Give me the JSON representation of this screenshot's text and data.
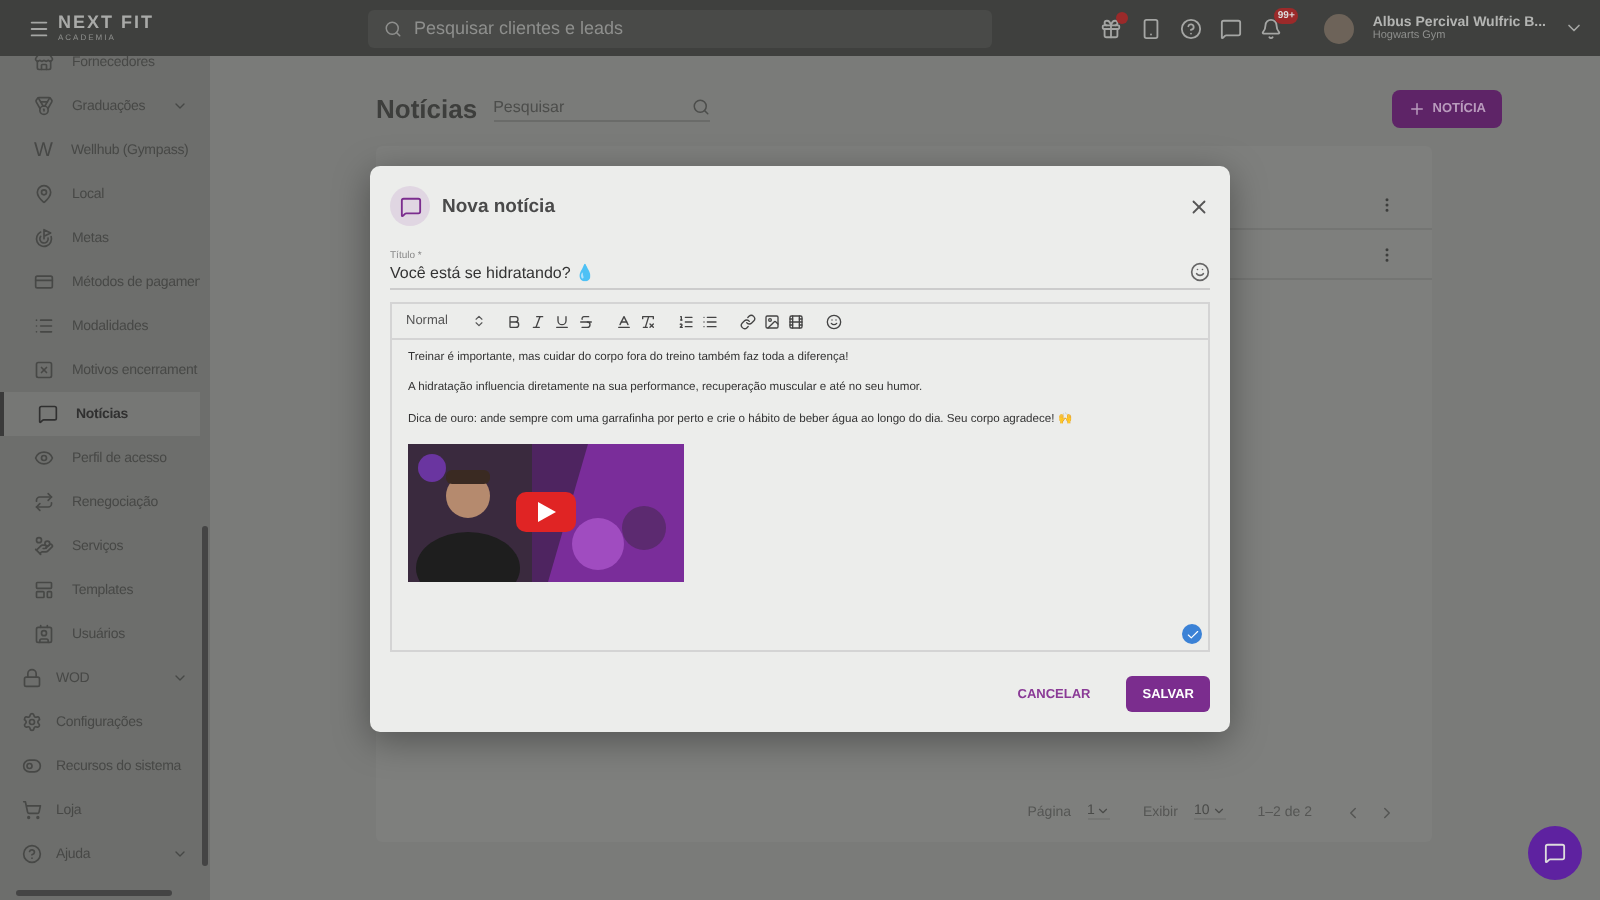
{
  "topbar": {
    "brand": "NEXT FIT",
    "brand_sub": "ACADEMIA",
    "search": {
      "placeholder": "Pesquisar clientes e leads"
    },
    "notifications_badge": "99+",
    "user": {
      "name": "Albus Percival Wulfric B...",
      "gym": "Hogwarts Gym"
    }
  },
  "sidebar": {
    "items": [
      {
        "label": "Fornecedores",
        "kind": "subitem",
        "expandable": false,
        "selected": false
      },
      {
        "label": "Graduações",
        "kind": "subitem",
        "expandable": true,
        "selected": false
      },
      {
        "label": "Wellhub (Gympass)",
        "kind": "subitem",
        "glyph": "W",
        "expandable": false,
        "selected": false
      },
      {
        "label": "Local",
        "kind": "subitem",
        "expandable": false,
        "selected": false
      },
      {
        "label": "Metas",
        "kind": "subitem",
        "expandable": false,
        "selected": false
      },
      {
        "label": "Métodos de pagamen",
        "kind": "subitem",
        "expandable": false,
        "selected": false
      },
      {
        "label": "Modalidades",
        "kind": "subitem",
        "expandable": false,
        "selected": false
      },
      {
        "label": "Motivos encerrament",
        "kind": "subitem",
        "expandable": false,
        "selected": false
      },
      {
        "label": "Notícias",
        "kind": "subitem",
        "expandable": false,
        "selected": true
      },
      {
        "label": "Perfil de acesso",
        "kind": "subitem",
        "expandable": false,
        "selected": false
      },
      {
        "label": "Renegociação",
        "kind": "subitem",
        "expandable": false,
        "selected": false
      },
      {
        "label": "Serviços",
        "kind": "subitem",
        "expandable": false,
        "selected": false
      },
      {
        "label": "Templates",
        "kind": "subitem",
        "expandable": false,
        "selected": false
      },
      {
        "label": "Usuários",
        "kind": "subitem",
        "expandable": false,
        "selected": false
      },
      {
        "label": "WOD",
        "kind": "item",
        "expandable": true,
        "selected": false
      },
      {
        "label": "Configurações",
        "kind": "item",
        "expandable": false,
        "selected": false
      },
      {
        "label": "Recursos do sistema",
        "kind": "item",
        "expandable": false,
        "selected": false
      },
      {
        "label": "Loja",
        "kind": "item",
        "expandable": false,
        "selected": false
      },
      {
        "label": "Ajuda",
        "kind": "item",
        "expandable": true,
        "selected": false
      }
    ]
  },
  "page": {
    "title": "Notícias",
    "search": {
      "placeholder": "Pesquisar"
    },
    "new_button": "NOTÍCIA",
    "pagination": {
      "page_label": "Página",
      "page": "1",
      "show_label": "Exibir",
      "per_page": "10",
      "range": "1–2 de 2"
    }
  },
  "dialog": {
    "title": "Nova notícia",
    "field_label": "Título *",
    "field_value": "Você está se hidratando? 💧",
    "editor": {
      "format": "Normal",
      "paragraphs": [
        "Treinar é importante, mas cuidar do corpo fora do treino também faz toda a diferença!",
        "A hidratação influencia diretamente na sua performance, recuperação muscular e até no seu humor.",
        "Dica de ouro: ande sempre com uma garrafinha por perto e crie o hábito de beber água ao longo do dia. Seu corpo agradece! 🙌"
      ]
    },
    "buttons": {
      "cancel": "CANCELAR",
      "save": "SALVAR"
    }
  }
}
